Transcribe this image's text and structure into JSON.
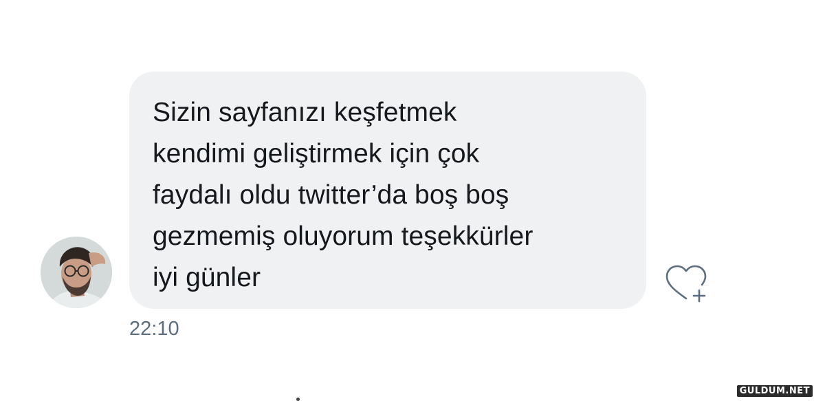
{
  "message": {
    "text": "Sizin sayfanızı keşfetmek\nkendimi geliştirmek için çok\nfaydalı oldu twitter’da boş boş\ngezmemiş oluyorum teşekkürler\niyi günler",
    "timestamp": "22:10"
  },
  "actions": {
    "like_icon": "heart-plus-icon"
  },
  "watermark": {
    "text": "GULDUM.NET"
  },
  "colors": {
    "bubble_background": "#eff1f2",
    "message_text": "#15181c",
    "timestamp_text": "#5c6d7e",
    "icon_stroke": "#5c6d7e"
  }
}
